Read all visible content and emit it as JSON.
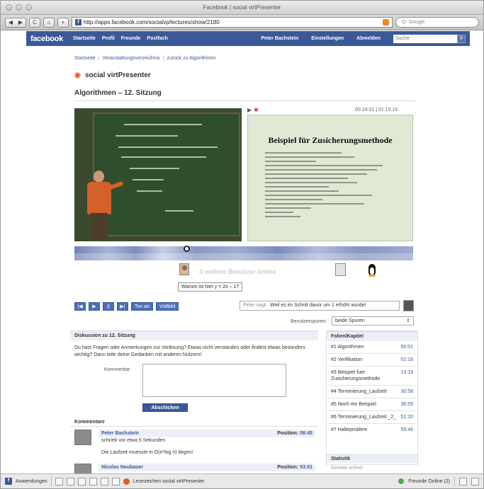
{
  "window": {
    "title": "Facebook | social virtPresenter"
  },
  "browser": {
    "back": "◀",
    "forward": "▶",
    "reload": "C",
    "home": "⌂",
    "add": "+",
    "url": "http://apps.facebook.com/socialvp/lectures/show/2180",
    "search_placeholder": "Q- Google"
  },
  "fb": {
    "logo": "facebook",
    "nav": [
      "Startseite",
      "Profil",
      "Freunde",
      "Postfach"
    ],
    "right": [
      "Peter Bachstein",
      "Einstellungen",
      "Abmelden"
    ],
    "search_placeholder": "Suche"
  },
  "breadcrumb": [
    "Startseite",
    "Veranstaltungsverzeichnis",
    "zurück zu Algorithmen"
  ],
  "app": {
    "title": "social virtPresenter",
    "session": "Algorithmen – 12. Sitzung"
  },
  "player": {
    "time": "00:24:31 | 01:15:19",
    "slide_title": "Beispiel für Zusicherungsmethode",
    "position_fraction": 0.33,
    "online_text": "3 weitere Benutzer online",
    "tooltip": "Warum ist hier y = 2x – 1?",
    "buttons": [
      "|◀",
      "▶",
      "||",
      "▶|"
    ],
    "btn_ton": "Ton an",
    "btn_vollbild": "Vollbild",
    "peter_who": "Peter sagt:",
    "peter_text": "Weil es im Schritt davor um 1 erhöht wurde!",
    "tracks_label": "Benutzerspuren:",
    "tracks_value": "beide Spuren"
  },
  "discussion": {
    "heading": "Diskussion zu 12. Sitzung",
    "intro": "Du hast Fragen oder Anmerkungen zur Vorlesung? Etwas nicht verstanden oder findest etwas besonders wichtig? Dann teile deine Gedanken mit anderen Nutzern!",
    "comment_label": "Kommentar:",
    "submit": "Abschicken",
    "comments_heading": "Kommentare",
    "comments": [
      {
        "name": "Peter Bachstein",
        "position_label": "Position:",
        "position": "08:45",
        "ago": "schrieb vor etwa 5 Sekunden",
        "body": "Die Laufzeit muesste in O(n*log n) liegen!"
      },
      {
        "name": "Nicolas Neubauer",
        "position_label": "Position:",
        "position": "53:01"
      }
    ]
  },
  "chapters": {
    "heading": "Folien/Kapitel",
    "items": [
      {
        "label": "#1 Algorithmen",
        "time": "00:01"
      },
      {
        "label": "#2 Verifikation",
        "time": "02:16"
      },
      {
        "label": "#3 Beispiel fuer Zusicherungsmethode",
        "time": "13:19"
      },
      {
        "label": "#4 Terminierung_Laufzeit",
        "time": "30:58"
      },
      {
        "label": "#5 Noch ein Beispiel",
        "time": "36:59"
      },
      {
        "label": "#6 Terminierung_Laufzeit _2_",
        "time": "51:20"
      },
      {
        "label": "#7 Halteproblem",
        "time": "59:46"
      }
    ],
    "stats_heading": "Statistik",
    "stats_sub": "Gerade online:"
  },
  "footer": {
    "apps": "Anwendungen",
    "bookmark": "Lesezeichen social virtPresenter",
    "friends_online": "Freunde Online (2)"
  },
  "colors": {
    "fb_blue": "#3b5998",
    "link": "#3b5998",
    "accent": "#e05a2b"
  }
}
